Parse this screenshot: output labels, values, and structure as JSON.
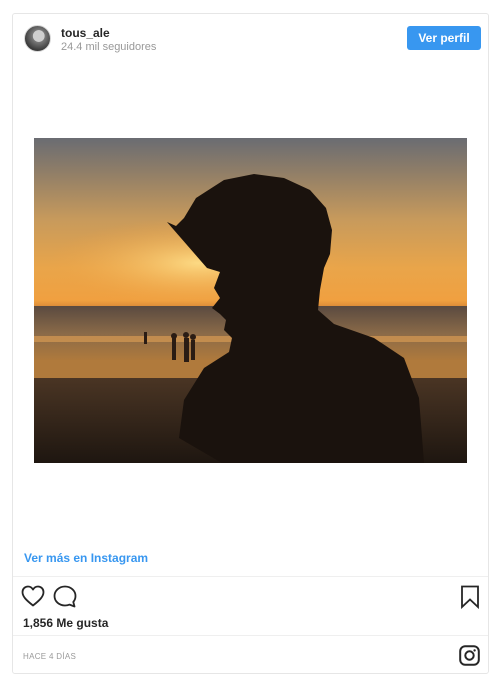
{
  "header": {
    "username": "tous_ale",
    "followers": "24.4 mil seguidores",
    "view_profile_label": "Ver perfil"
  },
  "footer": {
    "view_on_instagram": "Ver más en Instagram",
    "likes": "1,856 Me gusta",
    "timestamp": "HACE 4 DÍAS"
  },
  "icons": {
    "like": "heart-icon",
    "comment": "comment-icon",
    "save": "bookmark-icon",
    "brand": "instagram-icon"
  },
  "colors": {
    "accent": "#3897f0",
    "muted_text": "#999999",
    "text": "#262626",
    "border": "#e6e6e6"
  }
}
